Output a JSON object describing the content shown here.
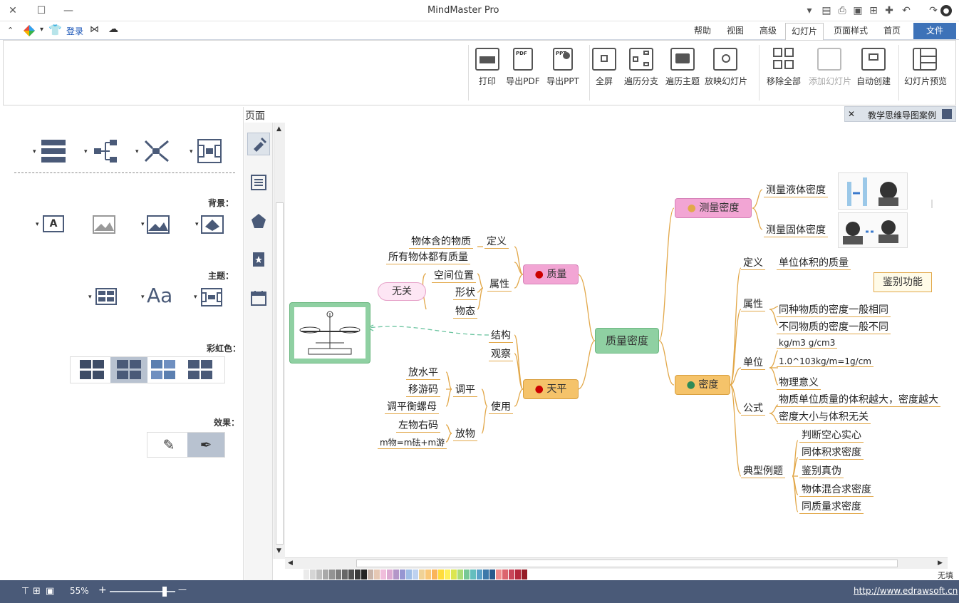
{
  "window": {
    "title": "MindMaster Pro",
    "controls": {
      "close": "✕",
      "maximize": "☐",
      "minimize": "—"
    }
  },
  "quick_toolbar": {
    "dropdown_icon": "▾"
  },
  "menubar": {
    "user": {
      "login": "登录"
    },
    "tabs": [
      "文件",
      "首页",
      "页面样式",
      "幻灯片",
      "高级",
      "视图",
      "帮助"
    ],
    "active_tab": "幻灯片"
  },
  "ribbon": {
    "buttons": [
      {
        "label": "幻灯片预览",
        "icon": "slide-preview-icon",
        "disabled": false
      },
      {
        "label": "自动创建",
        "icon": "auto-create-icon",
        "disabled": false
      },
      {
        "label": "添加幻灯片",
        "icon": "add-slide-icon",
        "disabled": true
      },
      {
        "label": "移除全部",
        "icon": "remove-all-icon",
        "disabled": false
      },
      {
        "label": "放映幻灯片",
        "icon": "play-slideshow-icon",
        "disabled": false
      },
      {
        "label": "遍历主题",
        "icon": "traverse-topic-icon",
        "disabled": false
      },
      {
        "label": "遍历分支",
        "icon": "traverse-branch-icon",
        "disabled": false
      },
      {
        "label": "全屏",
        "icon": "fullscreen-icon",
        "disabled": false
      },
      {
        "label": "导出PPT",
        "icon": "export-ppt-icon",
        "disabled": false
      },
      {
        "label": "导出PDF",
        "icon": "export-pdf-icon",
        "disabled": false
      },
      {
        "label": "打印",
        "icon": "print-icon",
        "disabled": false
      }
    ]
  },
  "left_panel": {
    "pin": "▸",
    "title": "页面",
    "sections": {
      "background": "背景：",
      "theme": "主题：",
      "rainbow": "彩虹色：",
      "effect": "效果："
    },
    "theme_font_sample": "Aa",
    "background_text_sample": "A"
  },
  "document_tab": {
    "name": "教学思维导图案例",
    "close": "✕"
  },
  "mindmap": {
    "center": "质量密度",
    "left_branches": [
      {
        "label": "质量",
        "marker": "1",
        "children": [
          {
            "label": "定义",
            "children": [
              "物体含的物质"
            ]
          },
          {
            "label": "所有物体都有质量",
            "children": []
          },
          {
            "label": "属性",
            "children": [
              "空间位置",
              "形状",
              "物态"
            ]
          }
        ],
        "callout": "无关"
      },
      {
        "label": "天平",
        "marker": "2",
        "children": [
          {
            "label": "结构",
            "children": []
          },
          {
            "label": "观察",
            "children": []
          },
          {
            "label": "使用",
            "children": [
              {
                "label": "调平",
                "children": [
                  "放水平",
                  "移游码",
                  "调平衡螺母"
                ]
              },
              {
                "label": "放物",
                "children": [
                  "左物右码",
                  "m物=m砝+m游"
                ]
              }
            ]
          }
        ]
      }
    ],
    "right_branches": [
      {
        "label": "测量密度",
        "children": [
          "测量液体密度",
          "测量固体密度"
        ]
      },
      {
        "label": "密度",
        "children": [
          {
            "label": "定义",
            "children": [
              "单位体积的质量"
            ]
          },
          {
            "label": "属性",
            "children": [
              "同种物质的密度一般相同",
              "不同物质的密度一般不同"
            ],
            "callout": "鉴别功能"
          },
          {
            "label": "单位",
            "children": [
              "kg/m3  g/cm3",
              "1.0^103kg/m=1g/cm",
              "物理意义"
            ]
          },
          {
            "label": "公式",
            "children": [
              "物质单位质量的体积越大，密度越大",
              "密度大小与体积无关"
            ]
          },
          {
            "label": "典型例题",
            "children": [
              "判断空心实心",
              "同体积求密度",
              "鉴别真伪",
              "物体混合求密度",
              "同质量求密度"
            ]
          }
        ]
      }
    ]
  },
  "palette_label": "无填充",
  "status": {
    "url": "http://www.edrawsoft.cn",
    "zoom": "55%",
    "zoom_in": "+",
    "zoom_out": "—"
  },
  "colors": {
    "accent": "#3d72b8",
    "center_node": "#8fd0a2",
    "mass_node": "#f2a5d4",
    "balance_node": "#f5c36a",
    "statusbar": "#4a5a78"
  }
}
